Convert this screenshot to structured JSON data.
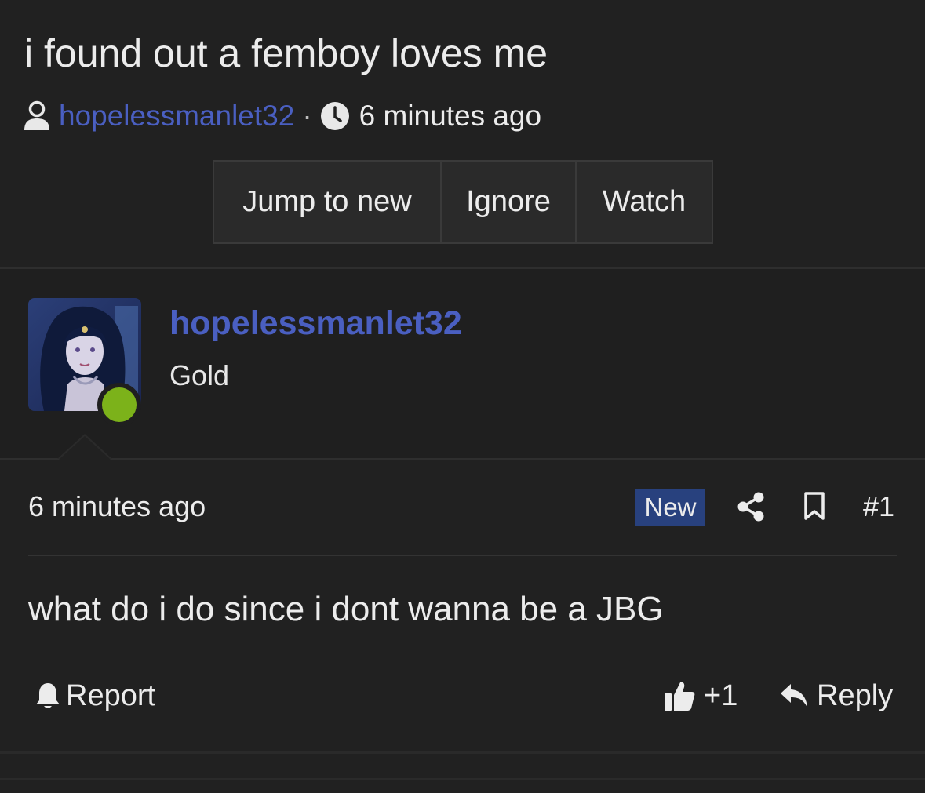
{
  "thread": {
    "title": "i found out a femboy loves me",
    "author": "hopelessmanlet32",
    "separator": "·",
    "time": "6 minutes ago",
    "buttons": {
      "jump_to_new": "Jump to new",
      "ignore": "Ignore",
      "watch": "Watch"
    }
  },
  "post": {
    "username": "hopelessmanlet32",
    "user_title": "Gold",
    "online": true,
    "time": "6 minutes ago",
    "badge": "New",
    "number": "#1",
    "body": "what do i do since i dont wanna be a JBG",
    "actions": {
      "report": "Report",
      "like_count": "+1",
      "reply": "Reply"
    }
  },
  "icons": {
    "author": "user-icon",
    "time": "clock-icon",
    "share": "share-icon",
    "bookmark": "bookmark-icon",
    "report": "bell-icon",
    "like": "thumbs-up-icon",
    "reply": "reply-icon"
  },
  "colors": {
    "background": "#212121",
    "link": "#4a5fc1",
    "online": "#7cb21a",
    "badge": "#28417e",
    "text": "#ececec"
  }
}
